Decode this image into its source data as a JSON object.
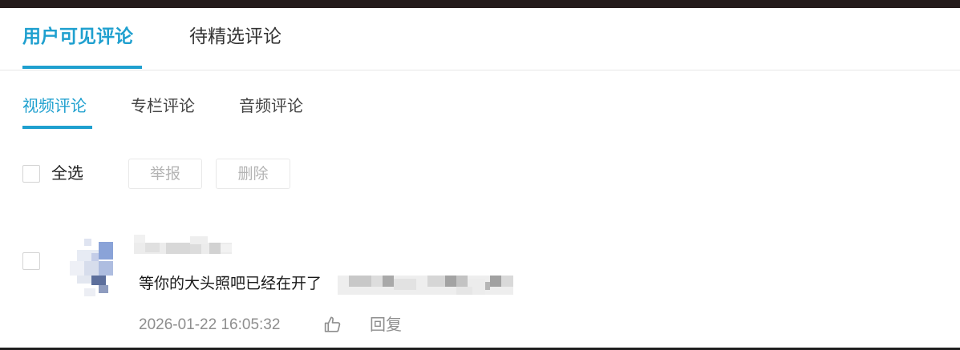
{
  "main_tabs": [
    {
      "label": "用户可见评论",
      "active": true
    },
    {
      "label": "待精选评论",
      "active": false
    }
  ],
  "sub_tabs": [
    {
      "label": "视频评论",
      "active": true
    },
    {
      "label": "专栏评论",
      "active": false
    },
    {
      "label": "音频评论",
      "active": false
    }
  ],
  "toolbar": {
    "select_all_label": "全选",
    "select_all_checked": false,
    "report_label": "举报",
    "delete_label": "删除"
  },
  "comments": [
    {
      "checked": false,
      "text": "等你的大头照吧已经在开了",
      "timestamp": "2026-01-22 16:05:32",
      "reply_label": "回复",
      "like_icon": "thumbs-up-icon"
    }
  ],
  "colors": {
    "accent": "#1fa0cf",
    "top_bar": "#241b1b",
    "muted_text": "#8e8e8e",
    "disabled_text": "#b4b4b4"
  }
}
